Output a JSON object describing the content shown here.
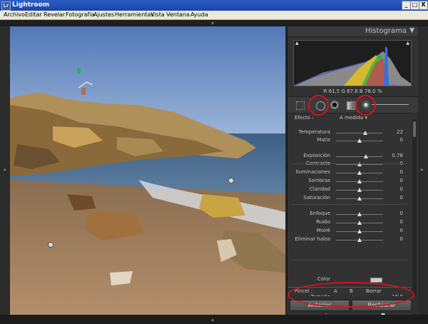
{
  "window": {
    "title": "Lightroom",
    "app_badge": "Lr"
  },
  "window_buttons": {
    "minimize": "_",
    "maximize": "□",
    "close": "X"
  },
  "menu": [
    "Archivo",
    "Editar",
    "Revelar",
    "Fotografía",
    "Ajustes",
    "Herramientas",
    "Vista",
    "Ventana",
    "Ayuda"
  ],
  "histogram": {
    "title": "Histograma",
    "readout": "R  61,5   G  67,8   B  78,0  %"
  },
  "tools": [
    "crop-overlay",
    "spot-removal",
    "red-eye",
    "graduated-filter",
    "adjustment-brush"
  ],
  "efecto": {
    "label": "Efecto :",
    "value": "A medida ▾"
  },
  "sliders": [
    {
      "label": "Temperatura",
      "value": "22",
      "pos": 0.62
    },
    {
      "label": "Matiz",
      "value": "0",
      "pos": 0.5
    },
    {
      "label": "Exposición",
      "value": "0,78",
      "pos": 0.64
    },
    {
      "label": "Contraste",
      "value": "0",
      "pos": 0.5
    },
    {
      "label": "Iluminaciones",
      "value": "0",
      "pos": 0.5
    },
    {
      "label": "Sombras",
      "value": "0",
      "pos": 0.5
    },
    {
      "label": "Claridad",
      "value": "0",
      "pos": 0.5
    },
    {
      "label": "Saturación",
      "value": "0",
      "pos": 0.5
    },
    {
      "label": "Enfoque",
      "value": "0",
      "pos": 0.5
    },
    {
      "label": "Ruido",
      "value": "0",
      "pos": 0.5
    },
    {
      "label": "Moiré",
      "value": "0",
      "pos": 0.5
    },
    {
      "label": "Eliminar halos",
      "value": "0",
      "pos": 0.5
    }
  ],
  "color": {
    "label": "Color"
  },
  "pincel": {
    "label": "Pincel :",
    "a": "A",
    "b": "B",
    "borrar": "Borrar"
  },
  "brush": [
    {
      "label": "Tamaño",
      "value": "16,0",
      "pos": 0.36
    },
    {
      "label": "Desvanecer",
      "value": "100",
      "pos": 1.0
    },
    {
      "label": "Flujo",
      "value": "100",
      "pos": 1.0
    }
  ],
  "buttons": {
    "previous": "Anterior",
    "reset": "Restaurar"
  }
}
